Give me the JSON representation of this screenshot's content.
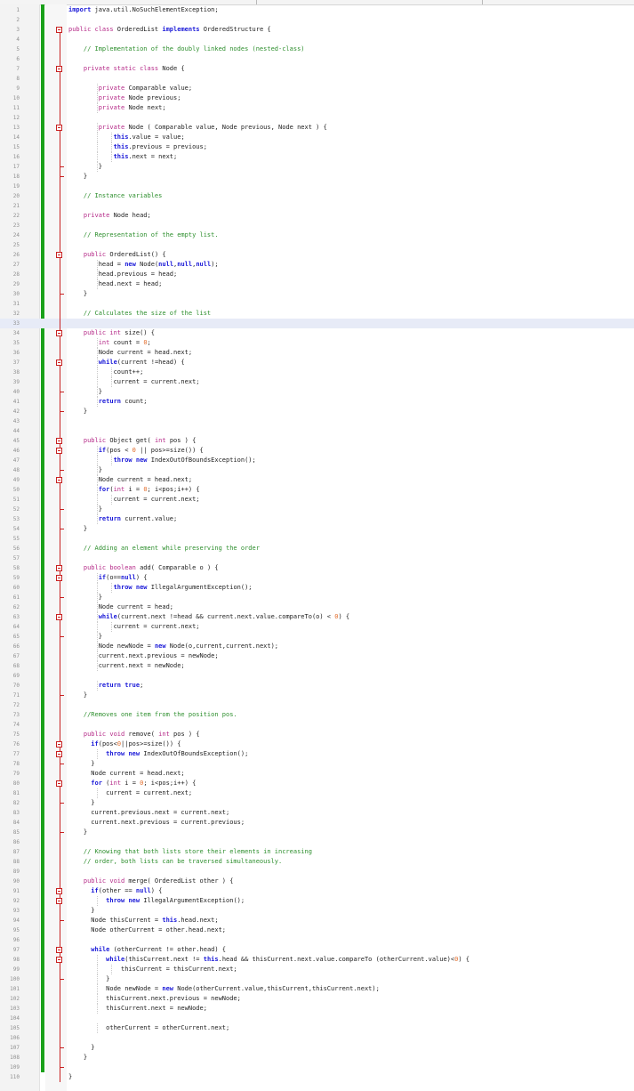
{
  "editor": {
    "current_line": 33,
    "lines": [
      [
        [
          "kw",
          "import"
        ],
        [
          "tx",
          " java.util.NoSuchElementException;"
        ]
      ],
      [],
      [
        [
          "ty",
          "public class"
        ],
        [
          "tx",
          " OrderedList "
        ],
        [
          "kw",
          "implements"
        ],
        [
          "tx",
          " OrderedStructure {"
        ]
      ],
      [],
      [
        [
          "tx",
          "    "
        ],
        [
          "cm",
          "// Implementation of the doubly linked nodes (nested-class)"
        ]
      ],
      [],
      [
        [
          "tx",
          "    "
        ],
        [
          "ty",
          "private static class"
        ],
        [
          "tx",
          " Node {"
        ]
      ],
      [],
      [
        [
          "tx",
          "        "
        ],
        [
          "ty",
          "private"
        ],
        [
          "tx",
          " Comparable value;"
        ]
      ],
      [
        [
          "tx",
          "        "
        ],
        [
          "ty",
          "private"
        ],
        [
          "tx",
          " Node previous;"
        ]
      ],
      [
        [
          "tx",
          "        "
        ],
        [
          "ty",
          "private"
        ],
        [
          "tx",
          " Node next;"
        ]
      ],
      [],
      [
        [
          "tx",
          "        "
        ],
        [
          "ty",
          "private"
        ],
        [
          "tx",
          " Node ( Comparable value, Node previous, Node next ) {"
        ]
      ],
      [
        [
          "tx",
          "            "
        ],
        [
          "kw",
          "this"
        ],
        [
          "tx",
          ".value = value;"
        ]
      ],
      [
        [
          "tx",
          "            "
        ],
        [
          "kw",
          "this"
        ],
        [
          "tx",
          ".previous = previous;"
        ]
      ],
      [
        [
          "tx",
          "            "
        ],
        [
          "kw",
          "this"
        ],
        [
          "tx",
          ".next = next;"
        ]
      ],
      [
        [
          "tx",
          "        }"
        ]
      ],
      [
        [
          "tx",
          "    }"
        ]
      ],
      [],
      [
        [
          "tx",
          "    "
        ],
        [
          "cm",
          "// Instance variables"
        ]
      ],
      [],
      [
        [
          "tx",
          "    "
        ],
        [
          "ty",
          "private"
        ],
        [
          "tx",
          " Node head;"
        ]
      ],
      [],
      [
        [
          "tx",
          "    "
        ],
        [
          "cm",
          "// Representation of the empty list."
        ]
      ],
      [],
      [
        [
          "tx",
          "    "
        ],
        [
          "ty",
          "public"
        ],
        [
          "tx",
          " OrderedList() {"
        ]
      ],
      [
        [
          "tx",
          "        head = "
        ],
        [
          "kw",
          "new"
        ],
        [
          "tx",
          " Node("
        ],
        [
          "kw",
          "null"
        ],
        [
          "tx",
          ","
        ],
        [
          "kw",
          "null"
        ],
        [
          "tx",
          ","
        ],
        [
          "kw",
          "null"
        ],
        [
          "tx",
          ");"
        ]
      ],
      [
        [
          "tx",
          "        head.previous = head;"
        ]
      ],
      [
        [
          "tx",
          "        head.next = head;"
        ]
      ],
      [
        [
          "tx",
          "    }"
        ]
      ],
      [],
      [
        [
          "tx",
          "    "
        ],
        [
          "cm",
          "// Calculates the size of the list"
        ]
      ],
      [],
      [
        [
          "tx",
          "    "
        ],
        [
          "ty",
          "public int"
        ],
        [
          "tx",
          " size() {"
        ]
      ],
      [
        [
          "tx",
          "        "
        ],
        [
          "ty",
          "int"
        ],
        [
          "tx",
          " count = "
        ],
        [
          "num",
          "0"
        ],
        [
          "tx",
          ";"
        ]
      ],
      [
        [
          "tx",
          "        Node current = head.next;"
        ]
      ],
      [
        [
          "tx",
          "        "
        ],
        [
          "kw",
          "while"
        ],
        [
          "tx",
          "(current !=head) {"
        ]
      ],
      [
        [
          "tx",
          "            count++;"
        ]
      ],
      [
        [
          "tx",
          "            current = current.next;"
        ]
      ],
      [
        [
          "tx",
          "        }"
        ]
      ],
      [
        [
          "tx",
          "        "
        ],
        [
          "kw",
          "return"
        ],
        [
          "tx",
          " count;"
        ]
      ],
      [
        [
          "tx",
          "    }"
        ]
      ],
      [],
      [],
      [
        [
          "tx",
          "    "
        ],
        [
          "ty",
          "public"
        ],
        [
          "tx",
          " Object get( "
        ],
        [
          "ty",
          "int"
        ],
        [
          "tx",
          " pos ) {"
        ]
      ],
      [
        [
          "tx",
          "        "
        ],
        [
          "kw",
          "if"
        ],
        [
          "tx",
          "(pos < "
        ],
        [
          "num",
          "0"
        ],
        [
          "tx",
          " || pos>=size()) {"
        ]
      ],
      [
        [
          "tx",
          "            "
        ],
        [
          "kw",
          "throw new"
        ],
        [
          "tx",
          " IndexOutOfBoundsException();"
        ]
      ],
      [
        [
          "tx",
          "        }"
        ]
      ],
      [
        [
          "tx",
          "        Node current = head.next;"
        ]
      ],
      [
        [
          "tx",
          "        "
        ],
        [
          "kw",
          "for"
        ],
        [
          "tx",
          "("
        ],
        [
          "ty",
          "int"
        ],
        [
          "tx",
          " i = "
        ],
        [
          "num",
          "0"
        ],
        [
          "tx",
          "; i<pos;i++) {"
        ]
      ],
      [
        [
          "tx",
          "            current = current.next;"
        ]
      ],
      [
        [
          "tx",
          "        }"
        ]
      ],
      [
        [
          "tx",
          "        "
        ],
        [
          "kw",
          "return"
        ],
        [
          "tx",
          " current.value;"
        ]
      ],
      [
        [
          "tx",
          "    }"
        ]
      ],
      [],
      [
        [
          "tx",
          "    "
        ],
        [
          "cm",
          "// Adding an element while preserving the order"
        ]
      ],
      [],
      [
        [
          "tx",
          "    "
        ],
        [
          "ty",
          "public boolean"
        ],
        [
          "tx",
          " add( Comparable o ) {"
        ]
      ],
      [
        [
          "tx",
          "        "
        ],
        [
          "kw",
          "if"
        ],
        [
          "tx",
          "(o=="
        ],
        [
          "kw",
          "null"
        ],
        [
          "tx",
          ") {"
        ]
      ],
      [
        [
          "tx",
          "            "
        ],
        [
          "kw",
          "throw new"
        ],
        [
          "tx",
          " IllegalArgumentException();"
        ]
      ],
      [
        [
          "tx",
          "        }"
        ]
      ],
      [
        [
          "tx",
          "        Node current = head;"
        ]
      ],
      [
        [
          "tx",
          "        "
        ],
        [
          "kw",
          "while"
        ],
        [
          "tx",
          "(current.next !=head && current.next.value.compareTo(o) < "
        ],
        [
          "num",
          "0"
        ],
        [
          "tx",
          ") {"
        ]
      ],
      [
        [
          "tx",
          "            current = current.next;"
        ]
      ],
      [
        [
          "tx",
          "        }"
        ]
      ],
      [
        [
          "tx",
          "        Node newNode = "
        ],
        [
          "kw",
          "new"
        ],
        [
          "tx",
          " Node(o,current,current.next);"
        ]
      ],
      [
        [
          "tx",
          "        current.next.previous = newNode;"
        ]
      ],
      [
        [
          "tx",
          "        current.next = newNode;"
        ]
      ],
      [],
      [
        [
          "tx",
          "        "
        ],
        [
          "kw",
          "return true"
        ],
        [
          "tx",
          ";"
        ]
      ],
      [
        [
          "tx",
          "    }"
        ]
      ],
      [],
      [
        [
          "tx",
          "    "
        ],
        [
          "cm",
          "//Removes one item from the position pos."
        ]
      ],
      [],
      [
        [
          "tx",
          "    "
        ],
        [
          "ty",
          "public void"
        ],
        [
          "tx",
          " remove( "
        ],
        [
          "ty",
          "int"
        ],
        [
          "tx",
          " pos ) {"
        ]
      ],
      [
        [
          "tx",
          "      "
        ],
        [
          "kw",
          "if"
        ],
        [
          "tx",
          "(pos<"
        ],
        [
          "num",
          "0"
        ],
        [
          "tx",
          "||pos>=size()) {"
        ]
      ],
      [
        [
          "tx",
          "          "
        ],
        [
          "kw",
          "throw new"
        ],
        [
          "tx",
          " IndexOutOfBoundsException();"
        ]
      ],
      [
        [
          "tx",
          "      }"
        ]
      ],
      [
        [
          "tx",
          "      Node current = head.next;"
        ]
      ],
      [
        [
          "tx",
          "      "
        ],
        [
          "kw",
          "for"
        ],
        [
          "tx",
          " ("
        ],
        [
          "ty",
          "int"
        ],
        [
          "tx",
          " i = "
        ],
        [
          "num",
          "0"
        ],
        [
          "tx",
          "; i<pos;i++) {"
        ]
      ],
      [
        [
          "tx",
          "          current = current.next;"
        ]
      ],
      [
        [
          "tx",
          "      }"
        ]
      ],
      [
        [
          "tx",
          "      current.previous.next = current.next;"
        ]
      ],
      [
        [
          "tx",
          "      current.next.previous = current.previous;"
        ]
      ],
      [
        [
          "tx",
          "    }"
        ]
      ],
      [],
      [
        [
          "tx",
          "    "
        ],
        [
          "cm",
          "// Knowing that both lists store their elements in increasing"
        ]
      ],
      [
        [
          "tx",
          "    "
        ],
        [
          "cm",
          "// order, both lists can be traversed simultaneously."
        ]
      ],
      [],
      [
        [
          "tx",
          "    "
        ],
        [
          "ty",
          "public void"
        ],
        [
          "tx",
          " merge( OrderedList other ) {"
        ]
      ],
      [
        [
          "tx",
          "      "
        ],
        [
          "kw",
          "if"
        ],
        [
          "tx",
          "(other == "
        ],
        [
          "kw",
          "null"
        ],
        [
          "tx",
          ") {"
        ]
      ],
      [
        [
          "tx",
          "          "
        ],
        [
          "kw",
          "throw new"
        ],
        [
          "tx",
          " IllegalArgumentException();"
        ]
      ],
      [
        [
          "tx",
          "      }"
        ]
      ],
      [
        [
          "tx",
          "      Node thisCurrent = "
        ],
        [
          "kw",
          "this"
        ],
        [
          "tx",
          ".head.next;"
        ]
      ],
      [
        [
          "tx",
          "      Node otherCurrent = other.head.next;"
        ]
      ],
      [],
      [
        [
          "tx",
          "      "
        ],
        [
          "kw",
          "while"
        ],
        [
          "tx",
          " (otherCurrent != other.head) {"
        ]
      ],
      [
        [
          "tx",
          "          "
        ],
        [
          "kw",
          "while"
        ],
        [
          "tx",
          "(thisCurrent.next != "
        ],
        [
          "kw",
          "this"
        ],
        [
          "tx",
          ".head && thisCurrent.next.value.compareTo (otherCurrent.value)<"
        ],
        [
          "num",
          "0"
        ],
        [
          "tx",
          ") {"
        ]
      ],
      [
        [
          "tx",
          "              thisCurrent = thisCurrent.next;"
        ]
      ],
      [
        [
          "tx",
          "          }"
        ]
      ],
      [
        [
          "tx",
          "          Node newNode = "
        ],
        [
          "kw",
          "new"
        ],
        [
          "tx",
          " Node(otherCurrent.value,thisCurrent,thisCurrent.next);"
        ]
      ],
      [
        [
          "tx",
          "          thisCurrent.next.previous = newNode;"
        ]
      ],
      [
        [
          "tx",
          "          thisCurrent.next = newNode;"
        ]
      ],
      [],
      [
        [
          "tx",
          "          otherCurrent = otherCurrent.next;"
        ]
      ],
      [],
      [
        [
          "tx",
          "      }"
        ]
      ],
      [
        [
          "tx",
          "    }"
        ]
      ],
      [],
      [
        [
          "tx",
          "}"
        ]
      ]
    ]
  }
}
